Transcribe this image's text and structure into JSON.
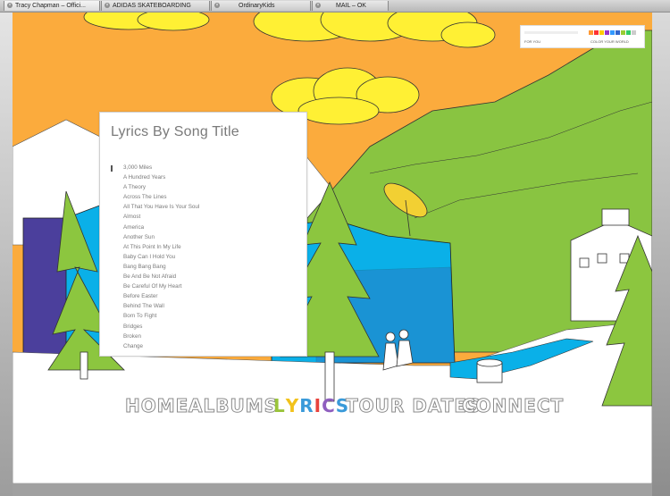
{
  "browser": {
    "tabs": [
      {
        "label": "Tracy Chapman – Offici...",
        "active": true
      },
      {
        "label": "ADIDAS SKATEBOARDING",
        "active": false
      },
      {
        "label": "OrdinaryKids",
        "active": false
      },
      {
        "label": "MAIL – OK",
        "active": false
      }
    ]
  },
  "color_widget": {
    "left_label": "FOR YOU",
    "right_label": "COLOR YOUR WORLD",
    "swatches": [
      "#ff9933",
      "#ff3333",
      "#ffcc00",
      "#9933cc",
      "#3399ff",
      "#3366cc",
      "#99cc33",
      "#33cc66",
      "#cccccc"
    ]
  },
  "lyrics": {
    "title": "Lyrics By Song Title",
    "songs": [
      "3,000 Miles",
      "A Hundred Years",
      "A Theory",
      "Across The Lines",
      "All That You Have Is Your Soul",
      "Almost",
      "America",
      "Another Sun",
      "At This Point In My Life",
      "Baby Can I Hold You",
      "Bang Bang Bang",
      "Be And Be Not Afraid",
      "Be Careful Of My Heart",
      "Before Easter",
      "Behind The Wall",
      "Born To Fight",
      "Bridges",
      "Broken",
      "Change"
    ]
  },
  "nav": {
    "home": "HOME",
    "albums": "ALBUMS",
    "lyrics": "LYRICS",
    "tour_dates": "TOUR DATES",
    "connect": "CONNECT",
    "lyrics_colors": [
      "#9ac43a",
      "#f2c21b",
      "#3a9ad9",
      "#e8423c",
      "#8f5fbf",
      "#3a9ad9"
    ]
  },
  "scene_colors": {
    "sky": "#fbab3d",
    "cloud": "#fff034",
    "mountain": "#89c441",
    "building": "#0ab0e8",
    "tree": "#8cc63f",
    "purple": "#4b3f9c",
    "snow": "#ffffff"
  }
}
